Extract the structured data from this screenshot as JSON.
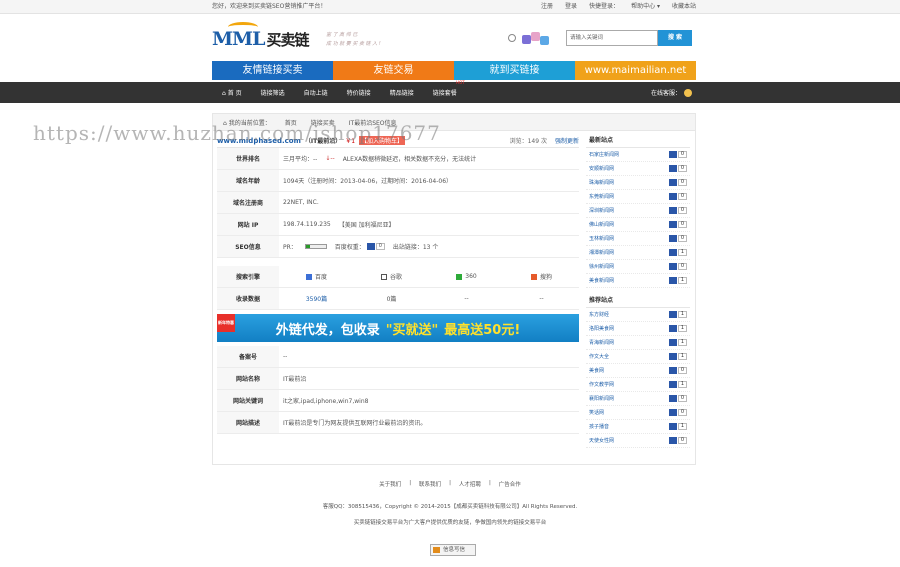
{
  "topbar": {
    "welcome": "您好，欢迎来到买卖链SEO营销推广平台！",
    "links": [
      "注册",
      "登录",
      "快捷登录：",
      "帮助中心 ▾",
      "收藏本站"
    ]
  },
  "header": {
    "logo": "MML",
    "logo_cn": "买卖链",
    "slogan_1": "富 了 高 帅 已",
    "slogan_2": "成 功 就 要 买 卖 链 入 !",
    "search_placeholder": "请输入关键词",
    "search_button": "搜 索"
  },
  "banner": [
    {
      "label": "友情链接买卖",
      "color": "#1a6bbf"
    },
    {
      "label": "友链交易",
      "color": "#f07a17"
    },
    {
      "label": "就到买链接",
      "color": "#1e9fd6"
    },
    {
      "label": "www.maimailian.net",
      "color": "#f0a21a"
    }
  ],
  "nav": {
    "items": [
      "首 页",
      "链接筛选",
      "自动上链",
      "特价链接",
      "精品链接",
      "链接套餐"
    ],
    "hot": "HOT",
    "service": "在线客服："
  },
  "breadcrumb": [
    "我的当前位置：",
    "首页",
    "链接买卖",
    "IT最前沿SEO信息"
  ],
  "site": {
    "url": "www.midphased.com",
    "name": "（IT最前沿）",
    "price": "￥1",
    "buy": "【加入购物车】",
    "views": "浏览：149 次",
    "refresh": "强制更新"
  },
  "rows": [
    {
      "k": "世界排名",
      "v": [
        "三月平均：--",
        "↓--",
        "ALEXA数据稍微延迟，相关数据不充分，无法统计"
      ]
    },
    {
      "k": "域名年龄",
      "v": [
        "1094天（注册时间：2013-04-06，过期时间：2016-04-06）"
      ]
    },
    {
      "k": "域名注册商",
      "v": [
        "22NET, INC."
      ]
    },
    {
      "k": "网站 IP",
      "v": [
        "198.74.119.235",
        "【美国 加利福尼亚】"
      ]
    },
    {
      "k": "SEO信息",
      "v": [
        "PR：",
        "百度权重：",
        "0",
        "出站链接：13 个"
      ]
    }
  ],
  "engines": {
    "label": "搜索引擎",
    "names": [
      "百度",
      "谷歌",
      "360",
      "搜狗"
    ],
    "count_label": "收录数据",
    "counts": [
      "3590篇",
      "0篇",
      "--",
      "--"
    ]
  },
  "ad": {
    "badge": "新年特惠",
    "text1": "外链代发，包收录",
    "text2": "\"买就送\"",
    "text3": "最高送50元!"
  },
  "info": [
    {
      "k": "备案号",
      "v": "--"
    },
    {
      "k": "网站名称",
      "v": "IT最前沿"
    },
    {
      "k": "网站关键词",
      "v": "it之家,ipad,iphone,win7,win8"
    },
    {
      "k": "网站描述",
      "v": "IT最前沿是专门为网友提供互联网行业最前沿的资讯。"
    }
  ],
  "side": {
    "latest_title": "最新站点",
    "latest": [
      {
        "n": "石家庄新闻网",
        "c": "0"
      },
      {
        "n": "安顺新闻网",
        "c": "0"
      },
      {
        "n": "珠海新闻网",
        "c": "0"
      },
      {
        "n": "东莞新闻网",
        "c": "0"
      },
      {
        "n": "深圳新闻网",
        "c": "0"
      },
      {
        "n": "佛山新闻网",
        "c": "0"
      },
      {
        "n": "玉林新闻网",
        "c": "0"
      },
      {
        "n": "湘潭新闻网",
        "c": "1"
      },
      {
        "n": "徐州新闻网",
        "c": "0"
      },
      {
        "n": "美食新闻网",
        "c": "1"
      }
    ],
    "recommend_title": "推荐站点",
    "recommend": [
      {
        "n": "东方财经",
        "c": "1"
      },
      {
        "n": "洛阳美食网",
        "c": "1"
      },
      {
        "n": "青海新闻网",
        "c": "1"
      },
      {
        "n": "作文大全",
        "c": "1"
      },
      {
        "n": "美食网",
        "c": "0"
      },
      {
        "n": "作文教学网",
        "c": "1"
      },
      {
        "n": "襄阳新闻网",
        "c": "0"
      },
      {
        "n": "笑话网",
        "c": "0"
      },
      {
        "n": "孩子播音",
        "c": "1"
      },
      {
        "n": "天使女性网",
        "c": "0"
      }
    ]
  },
  "footer": {
    "links": [
      "关于我们",
      "|",
      "联系我们",
      "|",
      "人才招聘",
      "|",
      "广告合作"
    ],
    "copyright": "客服QQ：308515436，Copyright © 2014-2015【成都买卖链科技有限公司】All Rights Reserved.",
    "desc": "买卖链链接交易平台为广大客户提供优质的友链，争做国内领先的链接交易平台",
    "feedback": "信息写信"
  },
  "watermark": "https://www.huzhan.com/ishop17677"
}
